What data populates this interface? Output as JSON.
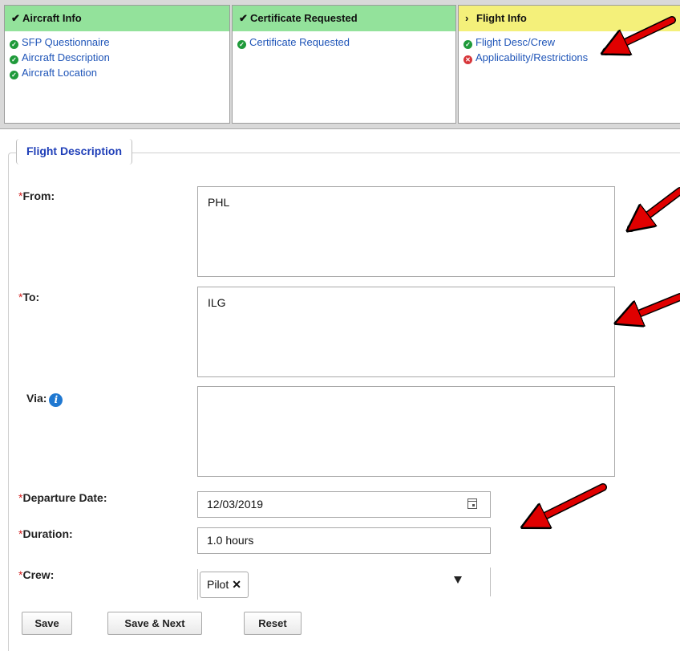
{
  "steps": [
    {
      "title": "Aircraft Info",
      "mark": "✔",
      "state": "done",
      "items": [
        {
          "label": "SFP Questionnaire",
          "status": "ok"
        },
        {
          "label": "Aircraft Description",
          "status": "ok"
        },
        {
          "label": "Aircraft Location",
          "status": "ok"
        }
      ]
    },
    {
      "title": "Certificate Requested",
      "mark": "✔",
      "state": "done",
      "items": [
        {
          "label": "Certificate Requested",
          "status": "ok"
        }
      ]
    },
    {
      "title": "Flight Info",
      "mark": "›",
      "state": "current",
      "items": [
        {
          "label": "Flight Desc/Crew",
          "status": "ok"
        },
        {
          "label": "Applicability/Restrictions",
          "status": "error"
        }
      ]
    }
  ],
  "form": {
    "legend": "Flight Description",
    "required_mark": "*",
    "from": {
      "label": "From:",
      "value": "PHL"
    },
    "to": {
      "label": "To:",
      "value": "ILG"
    },
    "via": {
      "label": "Via:",
      "value": ""
    },
    "departure_date": {
      "label": "Departure Date:",
      "value": "12/03/2019"
    },
    "duration": {
      "label": "Duration:",
      "value": "1.0 hours"
    },
    "crew": {
      "label": "Crew:",
      "selected": [
        "Pilot"
      ],
      "remove_glyph": "✕"
    }
  },
  "buttons": {
    "save": "Save",
    "save_next": "Save & Next",
    "reset": "Reset"
  },
  "colors": {
    "step_done": "#93e29b",
    "step_current": "#f4f07a",
    "link": "#1f55b8",
    "ok": "#1f9a3a",
    "error": "#d7363a",
    "legend": "#1f3fb8",
    "annotation_arrow": "#e00000"
  },
  "icons": {
    "ok": "check-circle-icon",
    "error": "x-circle-icon",
    "info": "info-icon",
    "calendar": "calendar-icon",
    "dropdown": "chevron-down-icon"
  }
}
